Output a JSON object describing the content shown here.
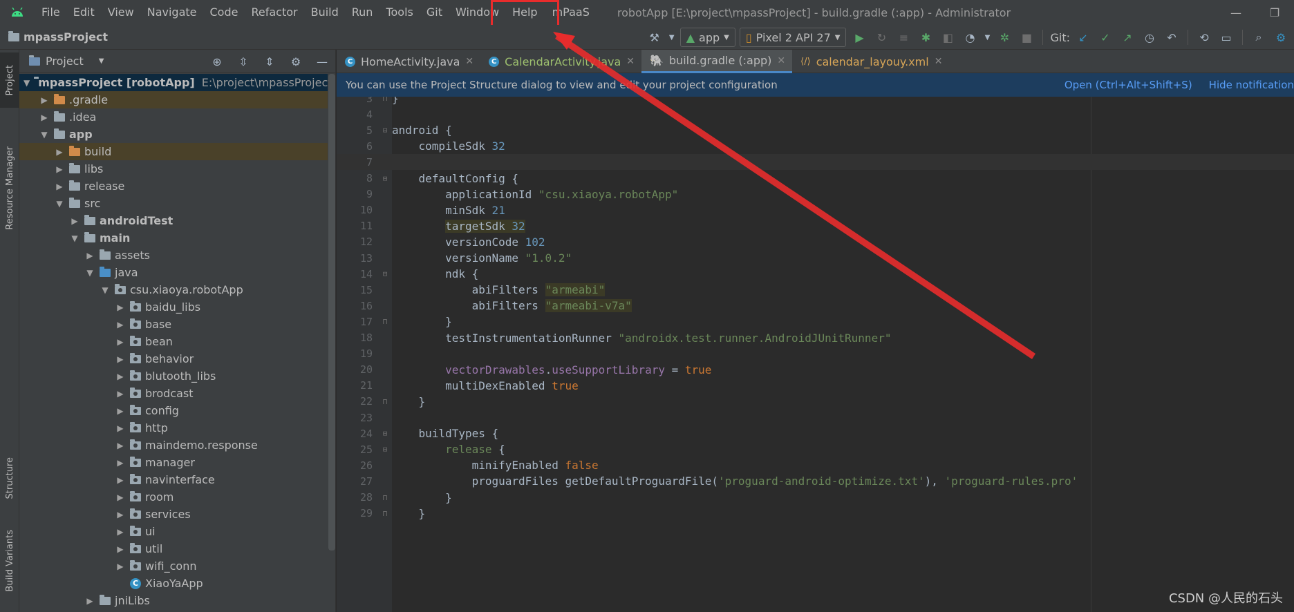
{
  "menubar": {
    "items": [
      "File",
      "Edit",
      "View",
      "Navigate",
      "Code",
      "Refactor",
      "Build",
      "Run",
      "Tools",
      "Git",
      "Window",
      "Help"
    ],
    "highlighted_item": "mPaaS",
    "window_title": "robotApp [E:\\project\\mpassProject] - build.gradle (:app) - Administrator",
    "minimize": "—",
    "restore": "❐"
  },
  "toolbar": {
    "project_name": "mpassProject",
    "run_config": "app",
    "device": "Pixel 2 API 27",
    "git_label": "Git:"
  },
  "left_strip": {
    "project_tab": "Project",
    "resource_tab": "Resource Manager",
    "structure_tab": "Structure",
    "build_variants_tab": "Build Variants"
  },
  "project_panel": {
    "title": "Project",
    "root_name": "mpassProject [robotApp]",
    "root_path": "E:\\project\\mpassProject",
    "tree": [
      {
        "label": ".gradle",
        "depth": 1,
        "chev": "right",
        "icon": "orange",
        "style": "excluded"
      },
      {
        "label": ".idea",
        "depth": 1,
        "chev": "right",
        "icon": "gray"
      },
      {
        "label": "app",
        "depth": 1,
        "chev": "down",
        "icon": "gray",
        "bold": true
      },
      {
        "label": "build",
        "depth": 2,
        "chev": "right",
        "icon": "orange",
        "style": "excluded"
      },
      {
        "label": "libs",
        "depth": 2,
        "chev": "right",
        "icon": "gray"
      },
      {
        "label": "release",
        "depth": 2,
        "chev": "right",
        "icon": "gray"
      },
      {
        "label": "src",
        "depth": 2,
        "chev": "down",
        "icon": "gray"
      },
      {
        "label": "androidTest",
        "depth": 3,
        "chev": "right",
        "icon": "gray",
        "bold": true
      },
      {
        "label": "main",
        "depth": 3,
        "chev": "down",
        "icon": "gray",
        "bold": true
      },
      {
        "label": "assets",
        "depth": 4,
        "chev": "right",
        "icon": "gray"
      },
      {
        "label": "java",
        "depth": 4,
        "chev": "down",
        "icon": "blue"
      },
      {
        "label": "csu.xiaoya.robotApp",
        "depth": 5,
        "chev": "down",
        "icon": "pkg"
      },
      {
        "label": "baidu_libs",
        "depth": 6,
        "chev": "right",
        "icon": "pkg"
      },
      {
        "label": "base",
        "depth": 6,
        "chev": "right",
        "icon": "pkg"
      },
      {
        "label": "bean",
        "depth": 6,
        "chev": "right",
        "icon": "pkg"
      },
      {
        "label": "behavior",
        "depth": 6,
        "chev": "right",
        "icon": "pkg"
      },
      {
        "label": "blutooth_libs",
        "depth": 6,
        "chev": "right",
        "icon": "pkg"
      },
      {
        "label": "brodcast",
        "depth": 6,
        "chev": "right",
        "icon": "pkg"
      },
      {
        "label": "config",
        "depth": 6,
        "chev": "right",
        "icon": "pkg"
      },
      {
        "label": "http",
        "depth": 6,
        "chev": "right",
        "icon": "pkg"
      },
      {
        "label": "maindemo.response",
        "depth": 6,
        "chev": "right",
        "icon": "pkg"
      },
      {
        "label": "manager",
        "depth": 6,
        "chev": "right",
        "icon": "pkg"
      },
      {
        "label": "navinterface",
        "depth": 6,
        "chev": "right",
        "icon": "pkg"
      },
      {
        "label": "room",
        "depth": 6,
        "chev": "right",
        "icon": "pkg"
      },
      {
        "label": "services",
        "depth": 6,
        "chev": "right",
        "icon": "pkg"
      },
      {
        "label": "ui",
        "depth": 6,
        "chev": "right",
        "icon": "pkg"
      },
      {
        "label": "util",
        "depth": 6,
        "chev": "right",
        "icon": "pkg"
      },
      {
        "label": "wifi_conn",
        "depth": 6,
        "chev": "right",
        "icon": "pkg"
      },
      {
        "label": "XiaoYaApp",
        "depth": 6,
        "chev": "none",
        "icon": "class"
      },
      {
        "label": "jniLibs",
        "depth": 4,
        "chev": "right",
        "icon": "gray"
      }
    ]
  },
  "editor_tabs": [
    {
      "name": "HomeActivity.java",
      "kind": "java"
    },
    {
      "name": "CalendarActivity.java",
      "kind": "java-cal"
    },
    {
      "name": "build.gradle (:app)",
      "kind": "gradle",
      "active": true
    },
    {
      "name": "calendar_layouy.xml",
      "kind": "xml"
    }
  ],
  "notification": {
    "message": "You can use the Project Structure dialog to view and edit your project configuration",
    "open_link": "Open (Ctrl+Alt+Shift+S)",
    "hide_link": "Hide notification"
  },
  "editor": {
    "current_line": 7,
    "lines": [
      {
        "n": "3",
        "fold": "close",
        "tokens": [
          [
            "",
            "}"
          ]
        ]
      },
      {
        "n": "4",
        "tokens": []
      },
      {
        "n": "5",
        "fold": "open",
        "tokens": [
          [
            "",
            "android {"
          ]
        ]
      },
      {
        "n": "6",
        "tokens": [
          [
            "",
            "    compileSdk "
          ],
          [
            "num",
            "32"
          ]
        ]
      },
      {
        "n": "7",
        "tokens": []
      },
      {
        "n": "8",
        "fold": "open",
        "tokens": [
          [
            "",
            "    defaultConfig {"
          ]
        ]
      },
      {
        "n": "9",
        "tokens": [
          [
            "",
            "        applicationId "
          ],
          [
            "str",
            "\"csu.xiaoya.robotApp\""
          ]
        ]
      },
      {
        "n": "10",
        "tokens": [
          [
            "",
            "        minSdk "
          ],
          [
            "num",
            "21"
          ]
        ]
      },
      {
        "n": "11",
        "tokens": [
          [
            "",
            "        "
          ],
          [
            "hl",
            "targetSdk "
          ],
          [
            "hlnum",
            "32"
          ]
        ]
      },
      {
        "n": "12",
        "tokens": [
          [
            "",
            "        versionCode "
          ],
          [
            "num",
            "102"
          ]
        ]
      },
      {
        "n": "13",
        "tokens": [
          [
            "",
            "        versionName "
          ],
          [
            "str",
            "\"1.0.2\""
          ]
        ]
      },
      {
        "n": "14",
        "fold": "open",
        "tokens": [
          [
            "",
            "        ndk {"
          ]
        ]
      },
      {
        "n": "15",
        "tokens": [
          [
            "",
            "            abiFilters "
          ],
          [
            "strhl",
            "\"armeabi\""
          ]
        ]
      },
      {
        "n": "16",
        "tokens": [
          [
            "",
            "            abiFilters "
          ],
          [
            "strhl",
            "\"armeabi-v7a\""
          ]
        ]
      },
      {
        "n": "17",
        "fold": "close",
        "tokens": [
          [
            "",
            "        }"
          ]
        ]
      },
      {
        "n": "18",
        "tokens": [
          [
            "",
            "        testInstrumentationRunner "
          ],
          [
            "str",
            "\"androidx.test.runner.AndroidJUnitRunner\""
          ]
        ]
      },
      {
        "n": "19",
        "tokens": []
      },
      {
        "n": "20",
        "tokens": [
          [
            "",
            "        "
          ],
          [
            "prop",
            "vectorDrawables"
          ],
          [
            "",
            "."
          ],
          [
            "prop",
            "useSupportLibrary"
          ],
          [
            "",
            " = "
          ],
          [
            "kw",
            "true"
          ]
        ]
      },
      {
        "n": "21",
        "tokens": [
          [
            "",
            "        multiDexEnabled "
          ],
          [
            "kw",
            "true"
          ]
        ]
      },
      {
        "n": "22",
        "fold": "close",
        "tokens": [
          [
            "",
            "    }"
          ]
        ]
      },
      {
        "n": "23",
        "tokens": []
      },
      {
        "n": "24",
        "fold": "open",
        "tokens": [
          [
            "",
            "    buildTypes {"
          ]
        ]
      },
      {
        "n": "25",
        "fold": "open",
        "tokens": [
          [
            "",
            "        "
          ],
          [
            "str",
            "release"
          ],
          [
            "",
            " {"
          ]
        ]
      },
      {
        "n": "26",
        "tokens": [
          [
            "",
            "            minifyEnabled "
          ],
          [
            "kw",
            "false"
          ]
        ]
      },
      {
        "n": "27",
        "tokens": [
          [
            "",
            "            proguardFiles getDefaultProguardFile("
          ],
          [
            "str",
            "'proguard-android-optimize.txt'"
          ],
          [
            "",
            "), "
          ],
          [
            "str",
            "'proguard-rules.pro'"
          ]
        ]
      },
      {
        "n": "28",
        "fold": "close",
        "tokens": [
          [
            "",
            "        }"
          ]
        ]
      },
      {
        "n": "29",
        "fold": "close",
        "tokens": [
          [
            "",
            "    }"
          ]
        ]
      }
    ]
  },
  "watermark": "CSDN @人民的石头",
  "colors": {
    "annotation_red": "#e82c2c",
    "accent_blue": "#4a88c7",
    "notification_bg": "#1d3d5e"
  }
}
